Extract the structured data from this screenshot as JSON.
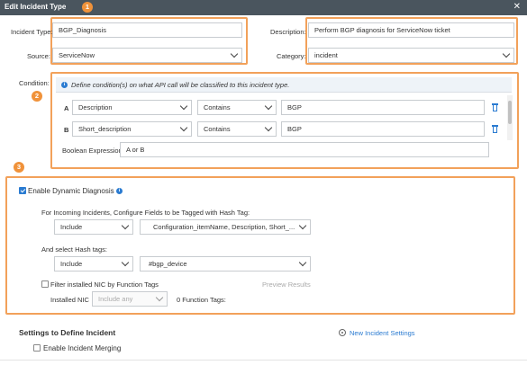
{
  "window": {
    "title": "Edit Incident Type",
    "close_icon": "close-icon"
  },
  "badges": {
    "one": "1",
    "two": "2",
    "three": "3"
  },
  "basic": {
    "incident_type_label": "Incident Type:",
    "incident_type_value": "BGP_Diagnosis",
    "description_label": "Description:",
    "description_value": "Perform BGP diagnosis for ServiceNow ticket",
    "source_label": "Source:",
    "source_value": "ServiceNow",
    "category_label": "Category:",
    "category_value": "incident"
  },
  "condition": {
    "label": "Condition:",
    "hint": "Define condition(s) on what API call will be classified to this incident type.",
    "rows": [
      {
        "id": "A",
        "field": "Description",
        "operator": "Contains",
        "value": "BGP"
      },
      {
        "id": "B",
        "field": "Short_description",
        "operator": "Contains",
        "value": "BGP"
      }
    ],
    "boolean_label": "Boolean Expression:",
    "boolean_value": "A or B"
  },
  "dynamic": {
    "enable_label": "Enable Dynamic Diagnosis",
    "enable_checked": true,
    "configure_label": "For Incoming Incidents, Configure Fields to be Tagged with Hash Tag:",
    "fields_mode": "Include",
    "fields_value": "Configuration_itemName, Description, Short_...",
    "hash_tags_label": "And select Hash tags:",
    "hash_mode": "Include",
    "hash_value": "#bgp_device",
    "filter_label": "Filter installed NIC by Function Tags",
    "filter_checked": false,
    "preview_label": "Preview Results",
    "installed_nic_label": "Installed NIC",
    "installed_nic_value": "Include any",
    "function_tags_label": "0 Function Tags:"
  },
  "settings": {
    "title": "Settings to Define Incident",
    "new_settings_link": "New Incident Settings",
    "merging_label": "Enable Incident Merging",
    "merging_checked": false
  },
  "colors": {
    "accent": "#2a7bd1",
    "highlight": "#f2a15a",
    "badge": "#f0923a",
    "titlebar": "#4a555e"
  }
}
